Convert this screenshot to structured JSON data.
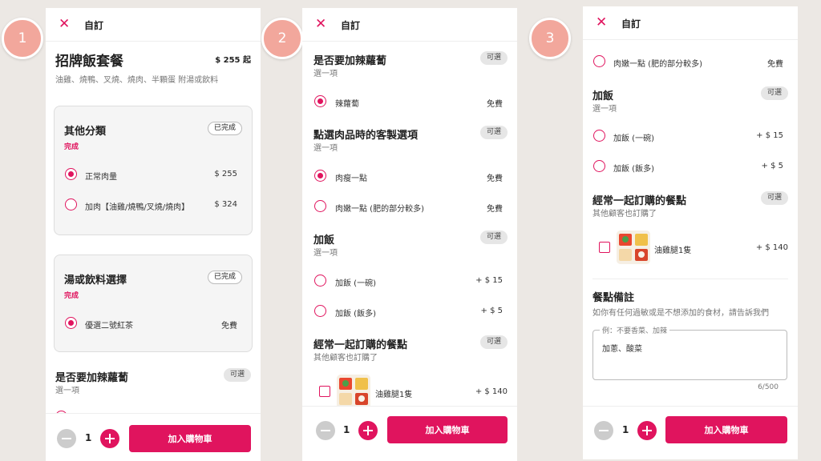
{
  "steps": [
    "1",
    "2",
    "3"
  ],
  "header": {
    "close_icon": "close-icon",
    "title": "自訂"
  },
  "accent_color": "#e0145e",
  "badges": {
    "optional": "可選",
    "completed": "已完成"
  },
  "item": {
    "name": "招牌飯套餐",
    "price": "$ 255 起",
    "description": "油雞、燒鴨、叉燒、燒肉、半顆蛋 附湯或飲料"
  },
  "groups": {
    "other": {
      "title": "其他分類",
      "status": "完成",
      "options": [
        {
          "label": "正常肉量",
          "price": "$ 255"
        },
        {
          "label": "加肉【油雞/燒鴨/叉燒/燒肉】",
          "price": "$ 324"
        }
      ]
    },
    "soup": {
      "title": "湯或飲料選擇",
      "status": "完成",
      "options": [
        {
          "label": "優選二號紅茶",
          "price": "免費"
        }
      ]
    },
    "chili": {
      "title": "是否要加辣蘿蔔",
      "subtitle": "選一項",
      "options": [
        {
          "label": "辣蘿蔔",
          "price": "免費"
        }
      ]
    },
    "meat": {
      "title": "點選肉品時的客製選項",
      "subtitle": "選一項",
      "options": [
        {
          "label": "肉瘦一點",
          "price": "免費"
        },
        {
          "label": "肉嫩一點 (肥的部分較多)",
          "price": "免費"
        }
      ]
    },
    "rice": {
      "title": "加飯",
      "subtitle": "選一項",
      "options": [
        {
          "label": "加飯 (一碗)",
          "price": "+ $ 15"
        },
        {
          "label": "加飯 (飯多)",
          "price": "+ $ 5"
        }
      ]
    },
    "often": {
      "title": "經常一起訂購的餐點",
      "subtitle": "其他顧客也訂購了",
      "options": [
        {
          "label": "油雞腿1隻",
          "price": "+ $ 140"
        }
      ]
    }
  },
  "notes": {
    "title": "餐點備註",
    "subtitle": "如你有任何過敏或是不想添加的食材，請告訴我們",
    "placeholder": "例：不要香菜、加辣",
    "value": "加蔥、酸菜",
    "count": "6/500"
  },
  "footer": {
    "quantity": "1",
    "add_to_cart": "加入購物車"
  }
}
